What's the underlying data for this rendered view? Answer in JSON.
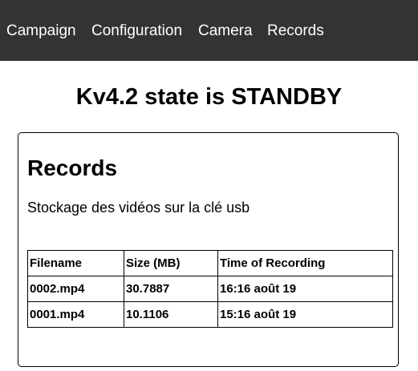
{
  "nav": {
    "items": [
      {
        "label": "Campaign"
      },
      {
        "label": "Configuration"
      },
      {
        "label": "Camera"
      },
      {
        "label": "Records"
      }
    ]
  },
  "state_title": "Kv4.2 state is STANDBY",
  "records": {
    "heading": "Records",
    "description": "Stockage des vidéos sur la clé usb",
    "columns": [
      "Filename",
      "Size (MB)",
      "Time of Recording"
    ],
    "rows": [
      [
        "0002.mp4",
        "30.7887",
        "16:16 août 19"
      ],
      [
        "0001.mp4",
        "10.1106",
        "15:16 août 19"
      ]
    ]
  },
  "colors": {
    "navbar_bg": "#333333",
    "navbar_text": "#ffffff"
  }
}
